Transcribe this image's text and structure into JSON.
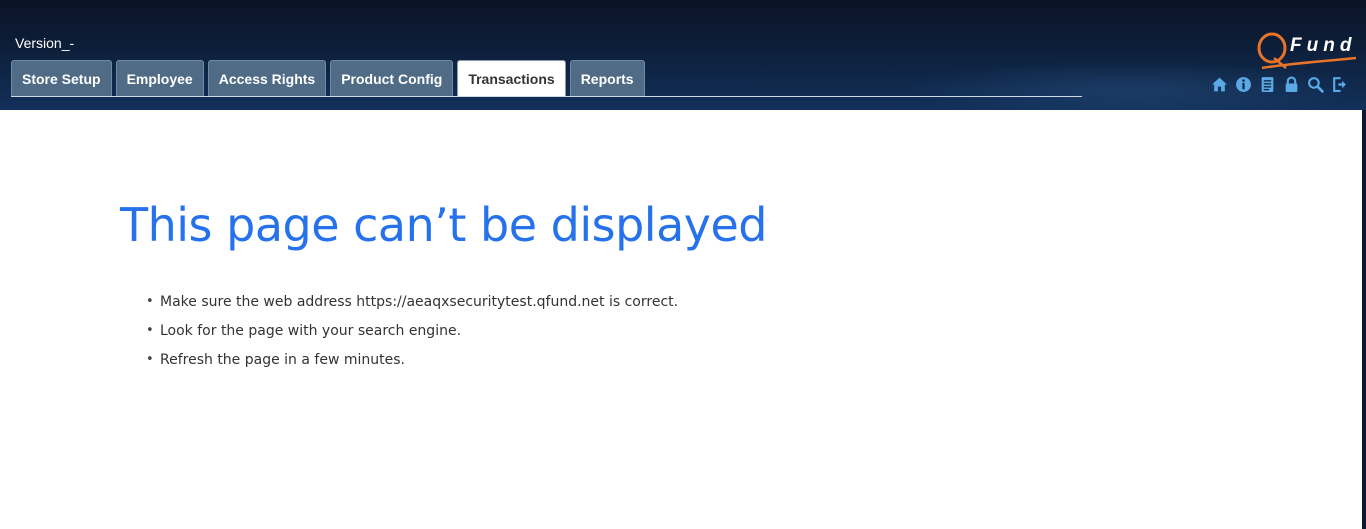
{
  "header": {
    "version_label": "Version_-",
    "tabs": [
      {
        "label": "Store Setup",
        "active": false
      },
      {
        "label": "Employee",
        "active": false
      },
      {
        "label": "Access Rights",
        "active": false
      },
      {
        "label": "Product Config",
        "active": false
      },
      {
        "label": "Transactions",
        "active": true
      },
      {
        "label": "Reports",
        "active": false
      }
    ],
    "logo": {
      "q": "Q",
      "text": "Fund",
      "accent_color": "#e8742a"
    },
    "toolbar_icons": [
      "home-icon",
      "info-icon",
      "document-icon",
      "lock-icon",
      "search-icon",
      "logout-icon"
    ],
    "icon_color": "#5aa9e6"
  },
  "error": {
    "title": "This page can’t be displayed",
    "title_color": "#2672ec",
    "bullet": "•",
    "suggestions": [
      "Make sure the web address https://aeaqxsecuritytest.qfund.net is correct.",
      "Look for the page with your search engine.",
      "Refresh the page in a few minutes."
    ]
  }
}
